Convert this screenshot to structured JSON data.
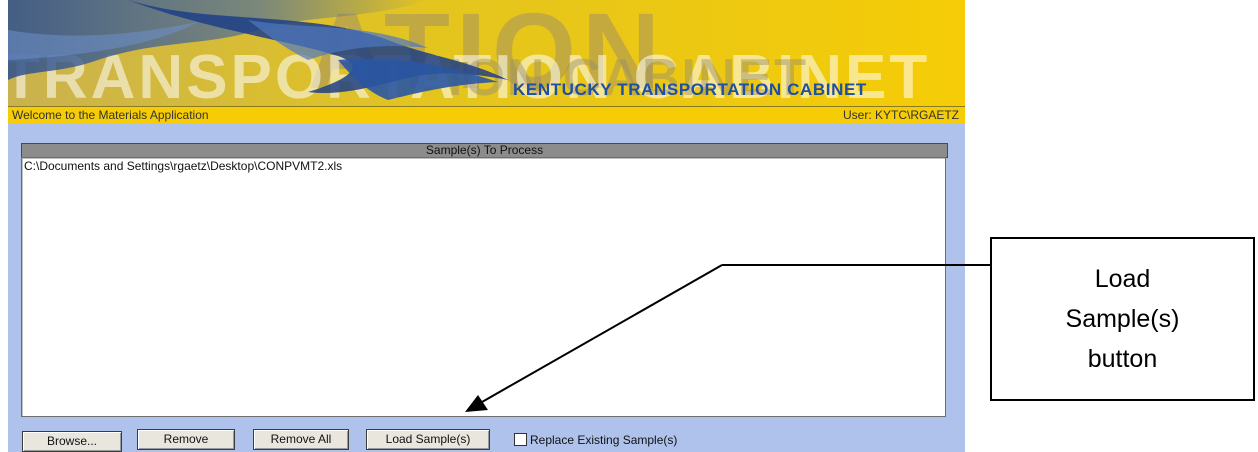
{
  "banner": {
    "watermark_large": "ATION",
    "watermark_left": "TRANSPORTATION CABINET",
    "watermark_mid": "ION CABINET",
    "cabinet_name": "KENTUCKY TRANSPORTATION CABINET"
  },
  "statusbar": {
    "welcome": "Welcome to the Materials Application",
    "user": "User: KYTC\\RGAETZ"
  },
  "panel": {
    "header": "Sample(s) To Process",
    "items": [
      "C:\\Documents and Settings\\rgaetz\\Desktop\\CONPVMT2.xls"
    ]
  },
  "buttons": {
    "browse": "Browse...",
    "remove": "Remove",
    "remove_all": "Remove All",
    "load_samples": "Load Sample(s)"
  },
  "replace_checkbox": {
    "label": "Replace Existing Sample(s)",
    "checked": false
  },
  "callout": {
    "line1": "Load",
    "line2": "Sample(s)",
    "line3": "button"
  },
  "colors": {
    "banner_yellow": "#f5cc06",
    "body_blue": "#aec2ec",
    "cabinet_text": "#1f4fa0"
  }
}
